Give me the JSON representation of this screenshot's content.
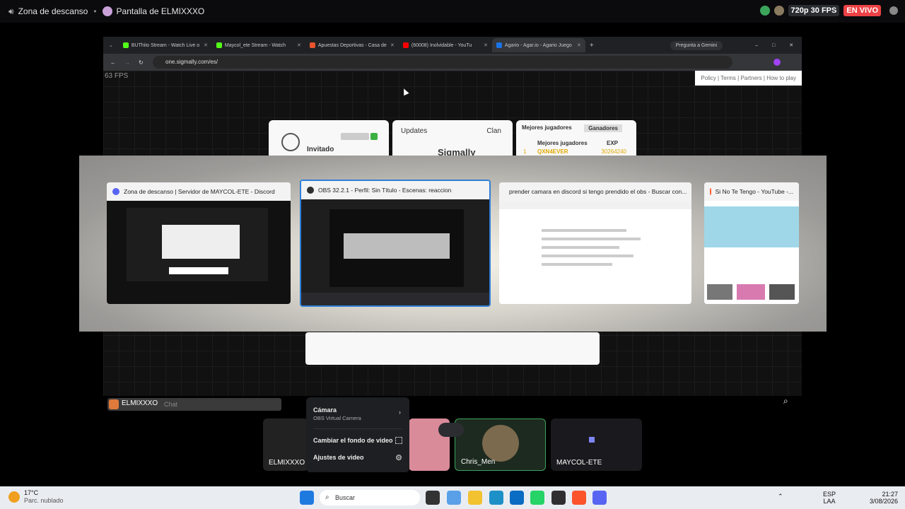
{
  "topbar": {
    "voice_channel": "Zona de descanso",
    "screen_label": "Pantalla de ELMIXXXO",
    "quality": "720p 30 FPS",
    "live": "EN VIVO"
  },
  "browser": {
    "tabs": [
      {
        "label": "BUThito Stream - Watch Live o",
        "color": "#53fc18"
      },
      {
        "label": "Maycol_ete Stream - Watch",
        "color": "#53fc18"
      },
      {
        "label": "Apuestas Deportivas - Casa de",
        "color": "#e8542c"
      },
      {
        "label": "(60008) Inolvidable - YouTu",
        "color": "#ff0000"
      },
      {
        "label": "Agario - Agar.io - Agario Juego",
        "color": "#1a73e8"
      }
    ],
    "gemini": "Pregunta a Gemini",
    "url": "one.sigmally.com/es/",
    "fps": "63 FPS",
    "footer_links": "Policy | Terms | Partners | How to play"
  },
  "game": {
    "player_label": "Invitado",
    "updates_tab": "Updates",
    "clan_tab": "Clan",
    "logo_text": "Sigmally",
    "leader_tab": "Mejores jugadores",
    "winners_tab": "Ganadores",
    "leader_header": "Mejores jugadores",
    "exp_header": "EXP",
    "top_player": "QXN4EVER",
    "top_rank": "1",
    "top_exp": "30264240"
  },
  "alttab": {
    "windows": [
      {
        "title": "Zona de descanso | Servidor de MAYCOL-ETE - Discord",
        "icon_color": "#5865f2"
      },
      {
        "title": "OBS 32.2.1 - Perfil: Sin Título - Escenas: reaccion",
        "icon_color": "#302e31"
      },
      {
        "title": "prender camara en discord si tengo prendido el obs - Buscar con...",
        "icon_color": "#fb542b"
      },
      {
        "title": "Si No Te Tengo - YouTube -...",
        "icon_color": "#fb542b"
      }
    ]
  },
  "call": {
    "chat_user": "ELMIXXXO",
    "chat_placeholder": "Chat",
    "tiles": [
      {
        "name": "ELMIXXXO"
      },
      {
        "name": "Chris_Men"
      },
      {
        "name": "MAYCOL-ETE"
      }
    ],
    "menu": {
      "camera_label": "Cámara",
      "camera_sub": "OBS Virtual Camera",
      "bg_label": "Cambiar el fondo de video",
      "settings_label": "Ajustes de video"
    }
  },
  "taskbar": {
    "weather_temp": "17°C",
    "weather_desc": "Parc. nublado",
    "search": "Buscar",
    "lang1": "ESP",
    "lang2": "LAA",
    "time": "21:27",
    "date": "3/08/2026"
  }
}
